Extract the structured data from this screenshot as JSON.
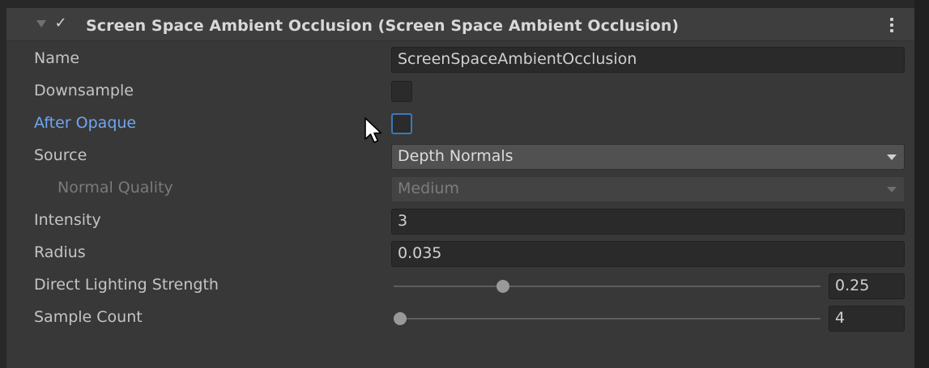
{
  "component": {
    "title": "Screen Space Ambient Occlusion (Screen Space Ambient Occlusion)",
    "enabled": true,
    "foldout_icon": "triangle-down-icon",
    "enabled_icon": "checkmark-icon",
    "menu_icon": "kebab-menu-icon"
  },
  "fields": {
    "name": {
      "label": "Name",
      "value": "ScreenSpaceAmbientOcclusion"
    },
    "downsample": {
      "label": "Downsample",
      "checked": false
    },
    "after_opaque": {
      "label": "After Opaque",
      "checked": false
    },
    "source": {
      "label": "Source",
      "value": "Depth Normals"
    },
    "normal_quality": {
      "label": "Normal Quality",
      "value": "Medium",
      "disabled": true
    },
    "intensity": {
      "label": "Intensity",
      "value": "3"
    },
    "radius": {
      "label": "Radius",
      "value": "0.035"
    },
    "direct_lighting_strength": {
      "label": "Direct Lighting Strength",
      "value": "0.25",
      "fraction": 0.25
    },
    "sample_count": {
      "label": "Sample Count",
      "value": "4",
      "fraction": 0.0
    }
  },
  "colors": {
    "highlight_label": "#6fa6f0",
    "focus_border": "#3a79bb"
  }
}
